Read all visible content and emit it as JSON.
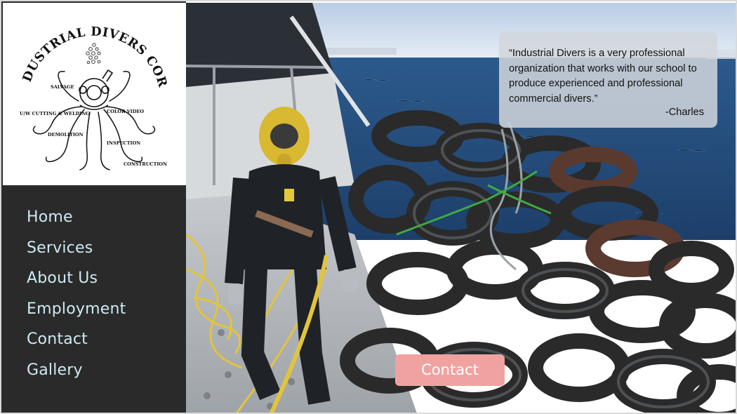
{
  "logo": {
    "company_name": "INDUSTRIAL DIVERS CORP.",
    "services": [
      "SALVAGE",
      "U/W CUTTING & WELDING",
      "COLOR VIDEO",
      "DEMOLITION",
      "INSPECTION",
      "CONSTRUCTION"
    ]
  },
  "nav": {
    "items": [
      {
        "label": "Home"
      },
      {
        "label": "Services"
      },
      {
        "label": "About Us"
      },
      {
        "label": "Employment"
      },
      {
        "label": "Contact"
      },
      {
        "label": "Gallery"
      }
    ]
  },
  "testimonial": {
    "text": "“Industrial Divers is a very professional organization that works with our school to produce experienced and professional commercial divers.”",
    "author": "-Charles"
  },
  "cta": {
    "label": "Contact"
  },
  "colors": {
    "sidebar_bg": "#2a2a2a",
    "nav_text": "#cfe9f3",
    "cta_bg": "#f0a2a1",
    "quote_bg": "#d2d6dc"
  }
}
